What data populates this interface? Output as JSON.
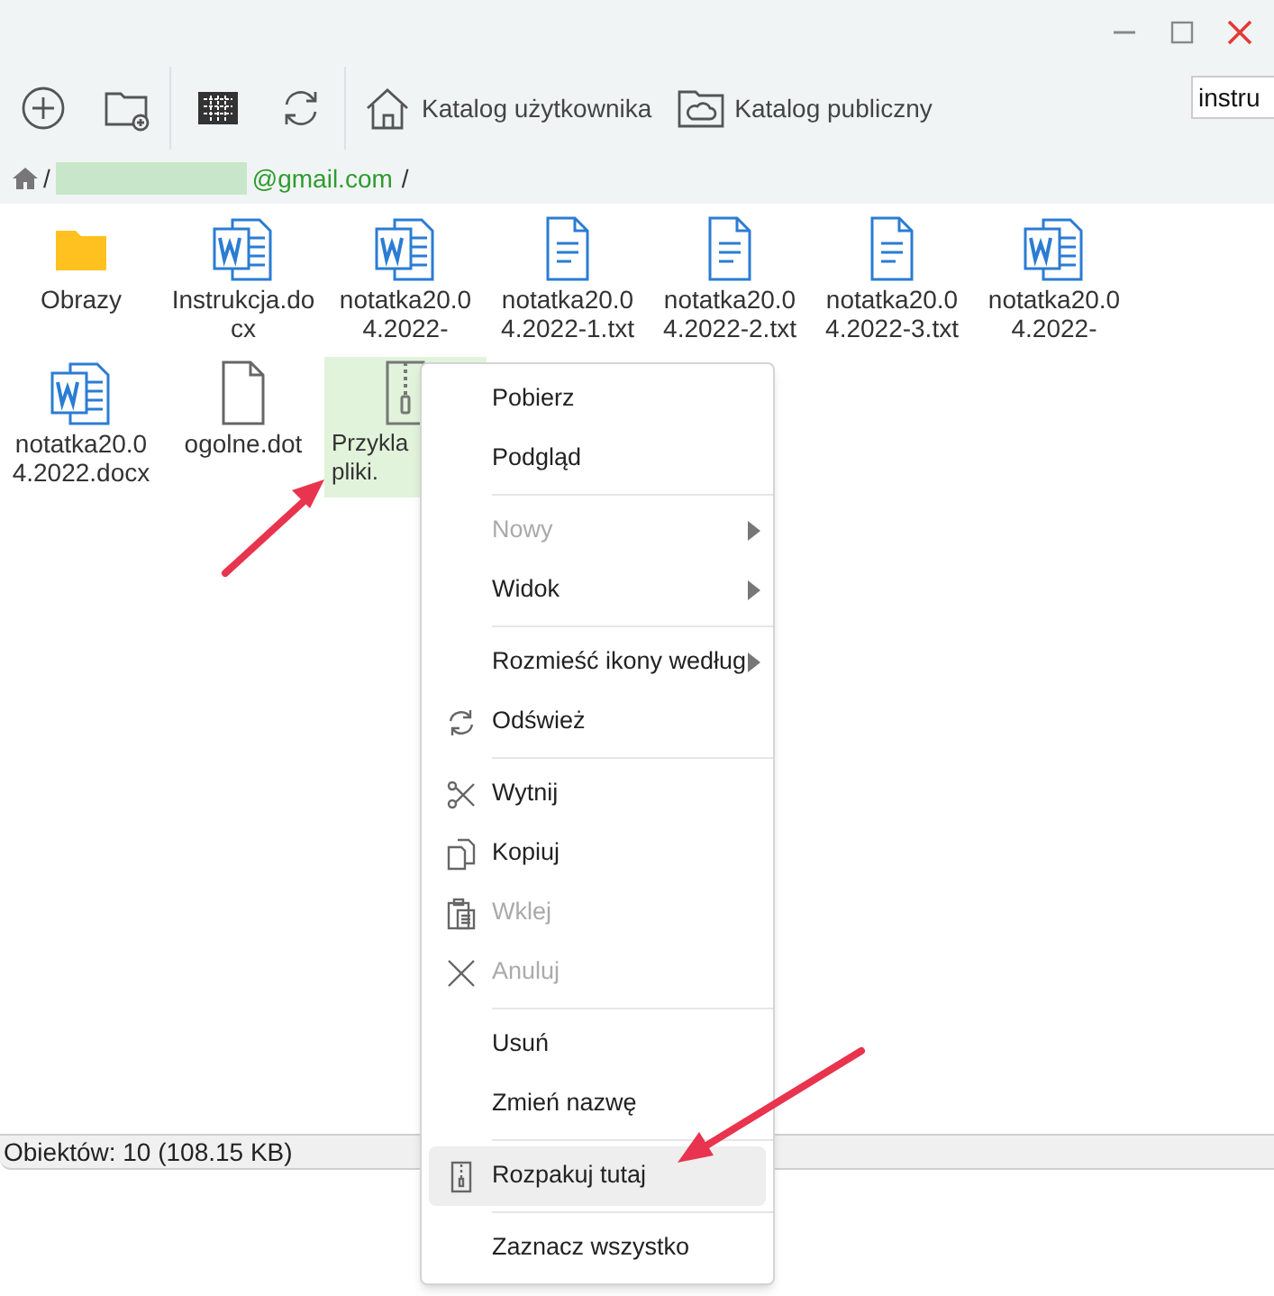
{
  "toolbar": {
    "buttons": [
      {
        "kind": "add"
      },
      {
        "kind": "new-folder"
      },
      {
        "kind": "grid-view"
      },
      {
        "kind": "refresh"
      }
    ],
    "locations": [
      {
        "kind": "home",
        "label": "Katalog użytkownika"
      },
      {
        "kind": "cloud",
        "label": "Katalog publiczny"
      }
    ],
    "search": {
      "value": "instru"
    }
  },
  "path": {
    "separator_1": "/",
    "account": "@gmail.com",
    "separator_2": "/"
  },
  "files": [
    {
      "kind": "folder",
      "name_lines": [
        "Obrazy"
      ],
      "selected": false
    },
    {
      "kind": "word",
      "name_lines": [
        "Instrukcja.do",
        "cx"
      ],
      "selected": false
    },
    {
      "kind": "word",
      "name_lines": [
        "notatka20.0",
        "4.2022-"
      ],
      "selected": false
    },
    {
      "kind": "text",
      "name_lines": [
        "notatka20.0",
        "4.2022-1.txt"
      ],
      "selected": false
    },
    {
      "kind": "text",
      "name_lines": [
        "notatka20.0",
        "4.2022-2.txt"
      ],
      "selected": false
    },
    {
      "kind": "text",
      "name_lines": [
        "notatka20.0",
        "4.2022-3.txt"
      ],
      "selected": false
    },
    {
      "kind": "word",
      "name_lines": [
        "notatka20.0",
        "4.2022-"
      ],
      "selected": false
    },
    {
      "kind": "word",
      "name_lines": [
        "notatka20.0",
        "4.2022.docx"
      ],
      "selected": false
    },
    {
      "kind": "blank",
      "name_lines": [
        "ogolne.dot"
      ],
      "selected": false
    },
    {
      "kind": "archive",
      "name_lines": [
        "Przykla",
        "pliki."
      ],
      "selected": true
    }
  ],
  "status_bar": "Obiektów: 10 (108.15 KB)",
  "context_menu": [
    {
      "kind": "item",
      "label": "Pobierz",
      "disabled": false,
      "submenu": false,
      "selected": false
    },
    {
      "kind": "item",
      "label": "Podgląd",
      "disabled": false,
      "submenu": false,
      "selected": false
    },
    {
      "kind": "separator"
    },
    {
      "kind": "item",
      "label": "Nowy",
      "disabled": true,
      "submenu": true,
      "selected": false
    },
    {
      "kind": "item",
      "label": "Widok",
      "disabled": false,
      "submenu": true,
      "selected": false
    },
    {
      "kind": "separator"
    },
    {
      "kind": "item",
      "label": "Rozmieść ikony według",
      "disabled": false,
      "submenu": true,
      "selected": false
    },
    {
      "kind": "refresh",
      "label": "Odśwież",
      "disabled": false,
      "submenu": false,
      "selected": false
    },
    {
      "kind": "separator"
    },
    {
      "kind": "cut",
      "label": "Wytnij",
      "disabled": false,
      "submenu": false,
      "selected": false
    },
    {
      "kind": "copy",
      "label": "Kopiuj",
      "disabled": false,
      "submenu": false,
      "selected": false
    },
    {
      "kind": "paste",
      "label": "Wklej",
      "disabled": true,
      "submenu": false,
      "selected": false
    },
    {
      "kind": "cancel",
      "label": "Anuluj",
      "disabled": true,
      "submenu": false,
      "selected": false
    },
    {
      "kind": "separator"
    },
    {
      "kind": "item",
      "label": "Usuń",
      "disabled": false,
      "submenu": false,
      "selected": false
    },
    {
      "kind": "item",
      "label": "Zmień nazwę",
      "disabled": false,
      "submenu": false,
      "selected": false
    },
    {
      "kind": "separator"
    },
    {
      "kind": "extract",
      "label": "Rozpakuj tutaj",
      "disabled": false,
      "submenu": false,
      "selected": true
    },
    {
      "kind": "separator"
    },
    {
      "kind": "item",
      "label": "Zaznacz wszystko",
      "disabled": false,
      "submenu": false,
      "selected": false
    }
  ]
}
